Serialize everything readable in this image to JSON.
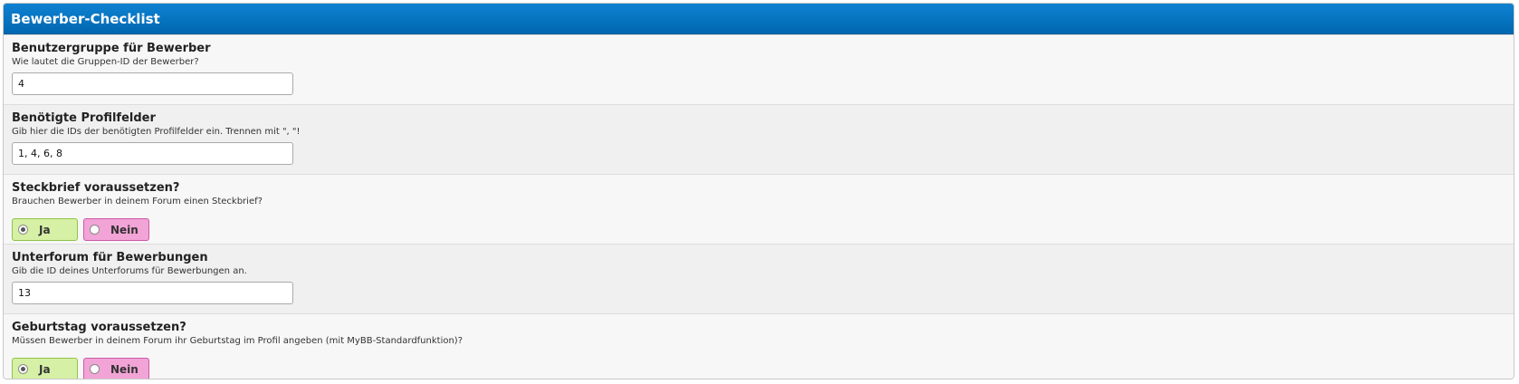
{
  "panel": {
    "title": "Bewerber-Checklist"
  },
  "settings": [
    {
      "title": "Benutzergruppe für Bewerber",
      "description": "Wie lautet die Gruppen-ID der Bewerber?",
      "type": "text",
      "value": "4"
    },
    {
      "title": "Benötigte Profilfelder",
      "description": "Gib hier die IDs der benötigten Profilfelder ein. Trennen mit \", \"!",
      "type": "text",
      "value": "1, 4, 6, 8"
    },
    {
      "title": "Steckbrief voraussetzen?",
      "description": "Brauchen Bewerber in deinem Forum einen Steckbrief?",
      "type": "yesno",
      "yes_label": "Ja",
      "no_label": "Nein",
      "selected": "Ja"
    },
    {
      "title": "Unterforum für Bewerbungen",
      "description": "Gib die ID deines Unterforums für Bewerbungen an.",
      "type": "text",
      "value": "13"
    },
    {
      "title": "Geburtstag voraussetzen?",
      "description": "Müssen Bewerber in deinem Forum ihr Geburtstag im Profil angeben (mit MyBB-Standardfunktion)?",
      "type": "yesno",
      "yes_label": "Ja",
      "no_label": "Nein",
      "selected": "Ja"
    }
  ],
  "colors": {
    "header_top": "#0f82d2",
    "header_bottom": "#0067b0",
    "yes_bg": "#d6f0a5",
    "no_bg": "#f2a4d6"
  }
}
